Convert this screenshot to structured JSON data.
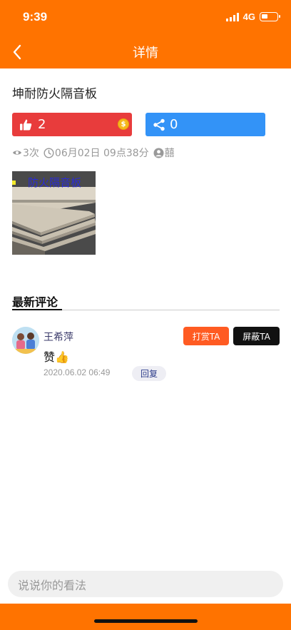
{
  "status_bar": {
    "time": "9:39",
    "network": "4G"
  },
  "nav": {
    "title": "详情"
  },
  "post": {
    "title": "坤耐防火隔音板",
    "likes": "2",
    "shares": "0",
    "views": "3次",
    "date": "06月02日 09点38分",
    "author": "囍",
    "image_caption": "防火隔音板"
  },
  "comments_section": {
    "title": "最新评论"
  },
  "comments": [
    {
      "author": "王希萍",
      "text": "赞👍",
      "time": "2020.06.02 06:49",
      "reply_label": "回复",
      "reward_label": "打赏TA",
      "block_label": "屏蔽TA"
    }
  ],
  "input": {
    "placeholder": "说说你的看法"
  },
  "colors": {
    "brand": "#ff7300",
    "like": "#e83c3c",
    "share": "#3393f7",
    "reward": "#ff5b22"
  },
  "icons": [
    "back-icon",
    "thumbs-up-icon",
    "coin-icon",
    "share-icon",
    "eye-icon",
    "clock-icon",
    "user-icon"
  ]
}
